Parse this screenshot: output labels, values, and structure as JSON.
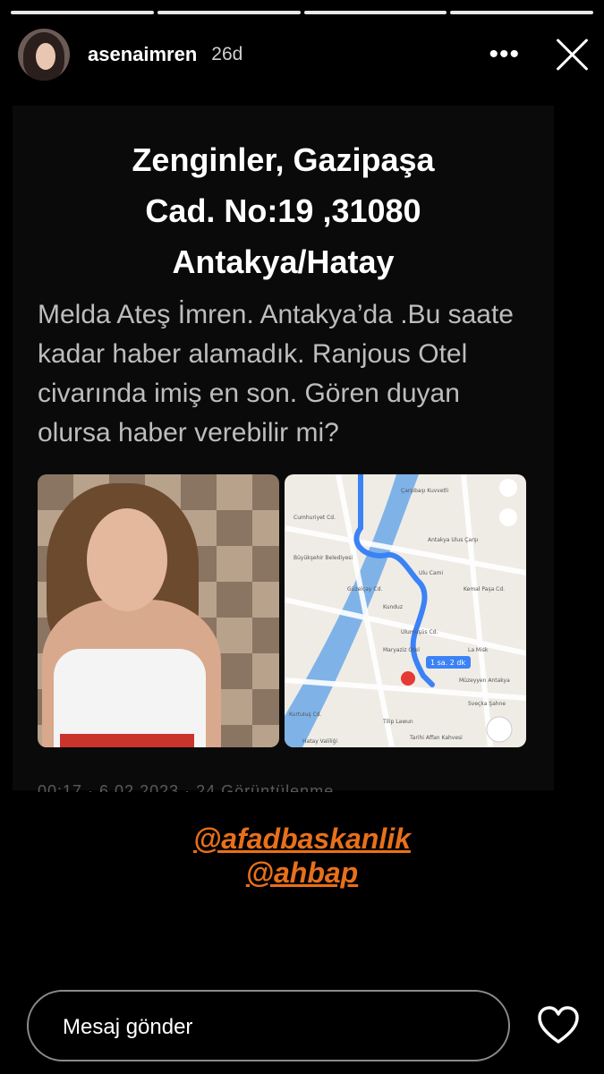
{
  "story": {
    "segments": [
      1,
      1,
      1,
      1
    ],
    "username": "asenaimren",
    "time": "26d",
    "more_label": "•••"
  },
  "post": {
    "address_lines": [
      "Zenginler, Gazipaşa",
      "Cad. No:19 ,31080",
      "Antakya/Hatay"
    ],
    "message": "Melda Ateş İmren. Antakya’da .Bu saate kadar haber alamadık. Ranjous Otel civarında imiş en son. Gören duyan olursa haber verebilir mi?",
    "views_text": "00:17 · 6.02.2023 · 24 Görüntülenme",
    "map": {
      "labels": [
        "Çarşıbaşı Kuvvetli",
        "Cumhuriyet Cd.",
        "Antakya Ulus Çarşı",
        "Ulu Cami",
        "Kemal Paşa Cd.",
        "Kunduz",
        "Büyükşehir Belediyesi",
        "Güzelçay Cd.",
        "Ulumüşüs Cd.",
        "Maryaziz Otel",
        "La Misk",
        "1 sa. 2 dk",
        "Müzeyyen Antakya",
        "Sveçka Şahne",
        "Tilip Lawun",
        "Hatay Valiliği",
        "Tarihi Affan Kahvesi",
        "Kurtuluş Cd."
      ],
      "route_badge": "1 sa. 2 dk"
    }
  },
  "mentions": [
    "@afadbaskanlik",
    "@ahbap"
  ],
  "footer": {
    "message_placeholder": "Mesaj gönder"
  },
  "colors": {
    "mention": "#e8701a",
    "route": "#3b82f6",
    "river": "#7fb3e8"
  }
}
